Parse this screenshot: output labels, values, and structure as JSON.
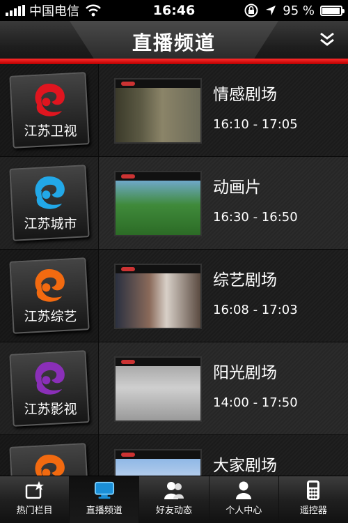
{
  "status_bar": {
    "carrier": "中国电信",
    "time": "16:46",
    "battery": "95 %",
    "battery_level": 0.95
  },
  "header": {
    "title": "直播频道",
    "collapse_icon": "double-chevron-down-icon"
  },
  "channels": [
    {
      "name": "江苏卫视",
      "color": "#e0151f",
      "program": "情感剧场",
      "time": "16:10 - 17:05"
    },
    {
      "name": "江苏城市",
      "color": "#22a8e8",
      "program": "动画片",
      "time": "16:30 - 16:50"
    },
    {
      "name": "江苏综艺",
      "color": "#f26a10",
      "program": "综艺剧场",
      "time": "16:08 - 17:03"
    },
    {
      "name": "江苏影视",
      "color": "#8a2fb8",
      "program": "阳光剧场",
      "time": "14:00 - 17:50"
    },
    {
      "name": "",
      "color": "#f26a10",
      "program": "大家剧场",
      "time": ""
    }
  ],
  "tabs": [
    {
      "label": "热门栏目",
      "icon": "star-folder-icon",
      "active": false
    },
    {
      "label": "直播频道",
      "icon": "tv-icon",
      "active": true
    },
    {
      "label": "好友动态",
      "icon": "friends-icon",
      "active": false
    },
    {
      "label": "个人中心",
      "icon": "person-icon",
      "active": false
    },
    {
      "label": "遥控器",
      "icon": "remote-control-icon",
      "active": false
    }
  ]
}
